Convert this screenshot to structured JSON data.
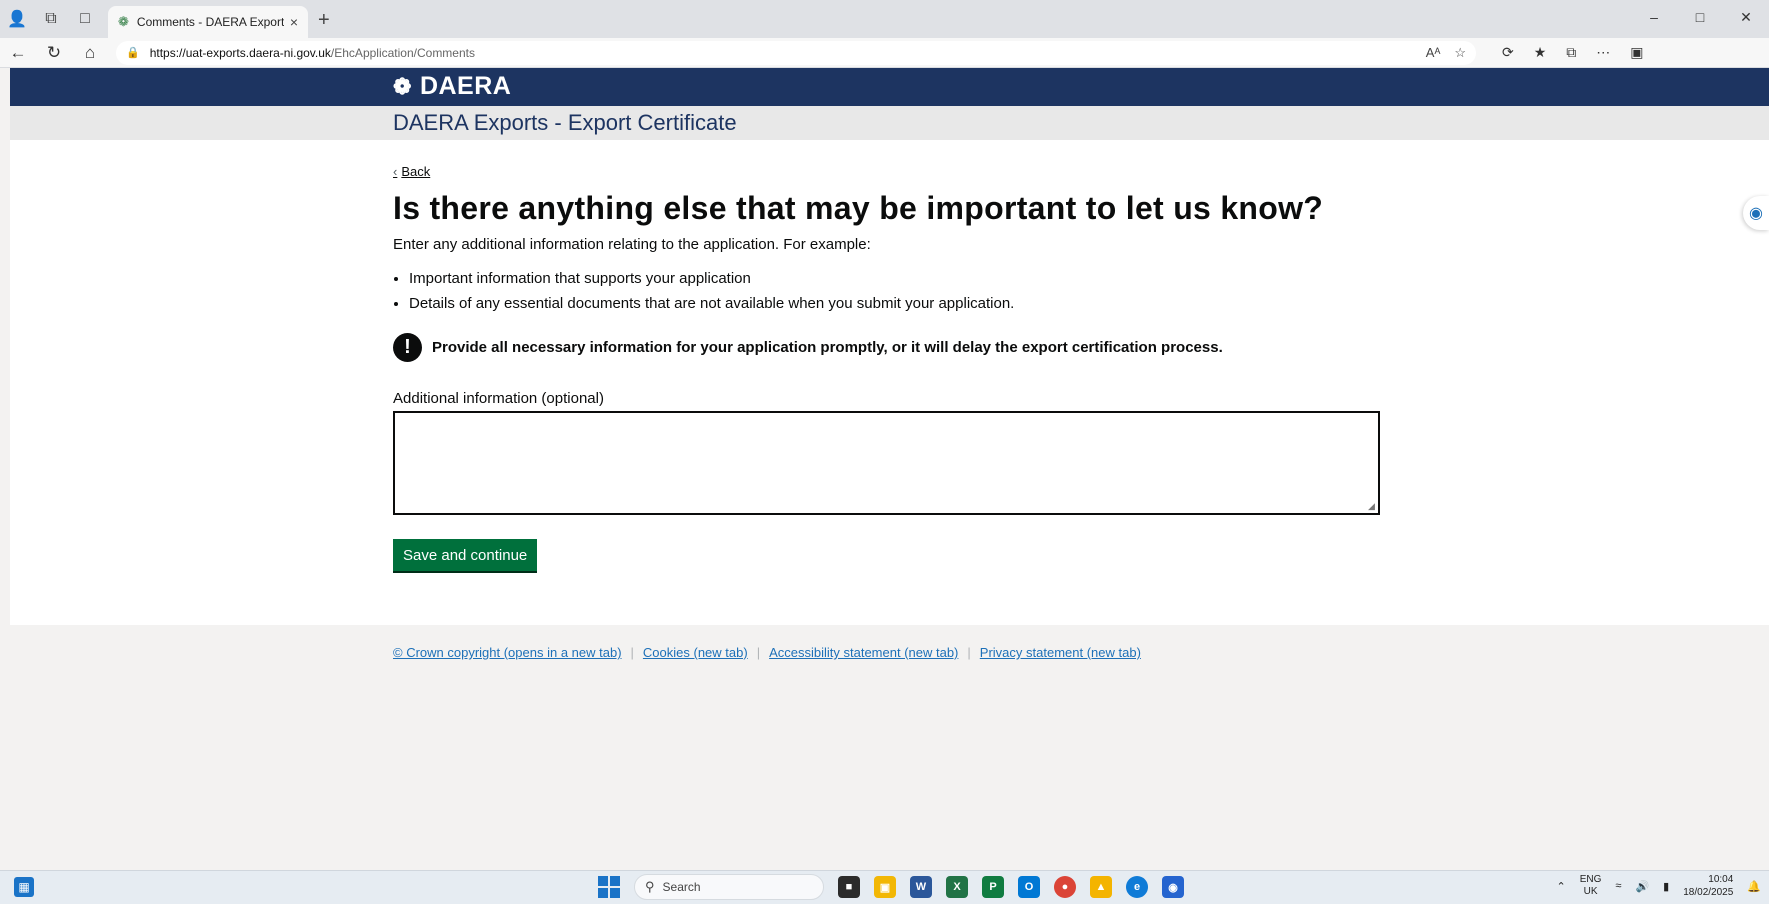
{
  "browser": {
    "tab_title": "Comments - DAERA Exports",
    "tab_close": "×",
    "new_tab": "+",
    "url_host": "https://uat-exports.daera-ni.gov.uk",
    "url_path": "/EhcApplication/Comments",
    "read_aloud": "Aᴬ"
  },
  "header": {
    "logo_text": "DAERA",
    "service_name": "DAERA Exports - Export Certificate"
  },
  "page": {
    "back_label": "Back",
    "heading": "Is there anything else that may be important to let us know?",
    "lead": "Enter any additional information relating to the application. For example:",
    "bullets": [
      "Important information that supports your application",
      "Details of any essential documents that are not available when you submit your application."
    ],
    "warning_icon": "!",
    "warning_text": "Provide all necessary information for your application promptly, or it will delay the export certification process.",
    "field_label": "Additional information (optional)",
    "field_value": "",
    "save_label": "Save and continue"
  },
  "footer": {
    "links": [
      "© Crown copyright (opens in a new tab)",
      "Cookies (new tab)",
      "Accessibility statement (new tab)",
      "Privacy statement (new tab)"
    ]
  },
  "taskbar": {
    "search_label": "Search",
    "lang_top": "ENG",
    "lang_bottom": "UK",
    "time": "10:04",
    "date": "18/02/2025"
  },
  "colors": {
    "header_bg": "#1d3461",
    "primary_button": "#00703c",
    "link": "#1d70b8"
  }
}
